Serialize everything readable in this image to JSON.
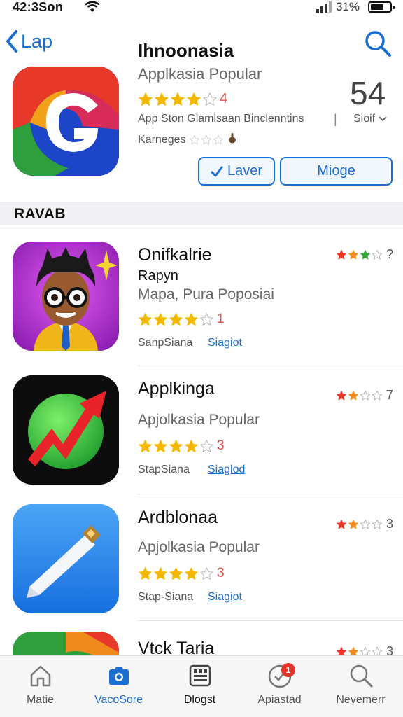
{
  "status_bar": {
    "time": "42:3Son",
    "battery": "31%"
  },
  "header": {
    "back_label": "Lap"
  },
  "featured": {
    "title": "Ihnoonasia",
    "subtitle": "Applkasia Popular",
    "rating_stars": 4,
    "rating_count": "4",
    "score": "54",
    "meta": "App Ston Glamlsaan Binclenntins",
    "separator": "|",
    "size": "Sioif",
    "ratings_label": "Karneges",
    "buttons": {
      "primary": "Laver",
      "secondary": "Mioge"
    }
  },
  "section": {
    "title": "RAVAB"
  },
  "apps": [
    {
      "title": "Onifkalrie",
      "developer": "Rapyn",
      "subtitle": "Mapa, Pura Poposiai",
      "stars": 4,
      "count": "1",
      "seller": "SanpSiana",
      "link": "Siagiot",
      "side_count": "?",
      "side_stars": 3
    },
    {
      "title": "Applkinga",
      "developer": "",
      "subtitle": "Apjolkasia Popular",
      "stars": 4,
      "count": "3",
      "seller": "StapSiana",
      "link": "Siaglod",
      "side_count": "7",
      "side_stars": 2
    },
    {
      "title": "Ardblonaa",
      "developer": "",
      "subtitle": "Apjolkasia Popular",
      "stars": 4,
      "count": "3",
      "seller": "Stap-Siana",
      "link": "Siagiot",
      "side_count": "3",
      "side_stars": 2
    },
    {
      "title": "Vtck Taria",
      "side_count": "3",
      "side_stars": 2
    }
  ],
  "tabs": [
    {
      "label": "Matie",
      "icon": "home-icon"
    },
    {
      "label": "VacoSore",
      "icon": "camera-icon"
    },
    {
      "label": "Dlogst",
      "icon": "grid-icon"
    },
    {
      "label": "Apiastad",
      "icon": "check-icon",
      "badge": "1"
    },
    {
      "label": "Nevemerr",
      "icon": "search-icon"
    }
  ],
  "colors": {
    "accent": "#1b6fd1",
    "star": "#f5b800",
    "badge": "#e5322b"
  }
}
